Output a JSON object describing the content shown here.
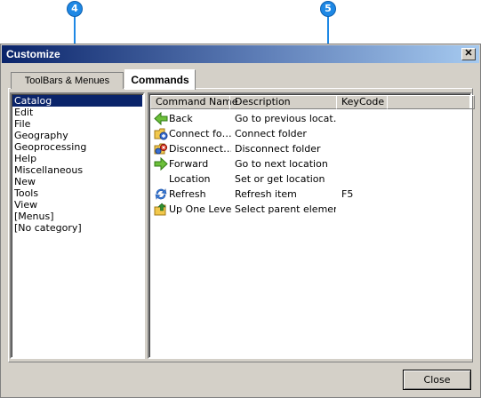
{
  "callouts": [
    {
      "number": "4"
    },
    {
      "number": "5"
    }
  ],
  "window": {
    "title": "Customize",
    "close_glyph": "✕"
  },
  "tabs": [
    {
      "label": "ToolBars & Menues",
      "selected": false
    },
    {
      "label": "Commands",
      "selected": true
    }
  ],
  "categories": [
    {
      "label": "Catalog",
      "selected": true
    },
    {
      "label": "Edit"
    },
    {
      "label": "File"
    },
    {
      "label": "Geography"
    },
    {
      "label": "Geoprocessing"
    },
    {
      "label": "Help"
    },
    {
      "label": "Miscellaneous"
    },
    {
      "label": "New"
    },
    {
      "label": "Tools"
    },
    {
      "label": "View"
    },
    {
      "label": "[Menus]"
    },
    {
      "label": "[No category]"
    }
  ],
  "commands": {
    "headers": {
      "name": "Command Name",
      "description": "Description",
      "keycode": "KeyCode"
    },
    "rows": [
      {
        "icon": "back-arrow-icon",
        "name": "Back",
        "description": "Go to previous locat…",
        "keycode": ""
      },
      {
        "icon": "connect-folder-icon",
        "name": "Connect fo…",
        "description": "Connect folder",
        "keycode": ""
      },
      {
        "icon": "disconnect-folder-icon",
        "name": "Disconnect…",
        "description": "Disconnect folder",
        "keycode": ""
      },
      {
        "icon": "forward-arrow-icon",
        "name": "Forward",
        "description": "Go to next location",
        "keycode": ""
      },
      {
        "icon": "",
        "name": "Location",
        "description": "Set or get location",
        "keycode": ""
      },
      {
        "icon": "refresh-icon",
        "name": "Refresh",
        "description": "Refresh item",
        "keycode": "F5"
      },
      {
        "icon": "up-folder-icon",
        "name": "Up One Level",
        "description": "Select parent element",
        "keycode": ""
      }
    ]
  },
  "buttons": {
    "close_label": "Close"
  },
  "colors": {
    "selection": "#0a246a",
    "callout": "#1e88e5",
    "dialog_bg": "#d4d0c8"
  }
}
